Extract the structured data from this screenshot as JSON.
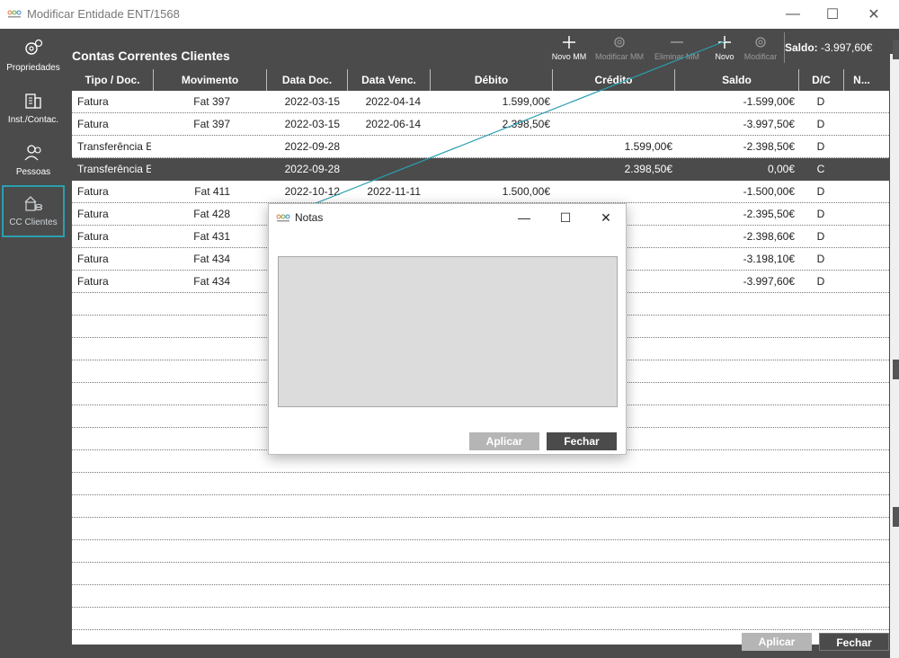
{
  "window": {
    "title": "Modificar Entidade ENT/1568",
    "controls": {
      "minimize": "—",
      "maximize": "☐",
      "close": "✕"
    }
  },
  "sidebar": {
    "items": [
      {
        "label": "Propriedades",
        "icon": "gears-icon"
      },
      {
        "label": "Inst./Contac.",
        "icon": "building-icon"
      },
      {
        "label": "Pessoas",
        "icon": "people-icon"
      },
      {
        "label": "CC Clientes",
        "icon": "cc-clientes-icon",
        "active": true
      }
    ]
  },
  "header": {
    "title": "Contas Correntes Clientes",
    "toolbar": {
      "novo_mm": "Novo MM",
      "modificar_mm": "Modificar MM",
      "eliminar_mm": "Eliminar MM",
      "novo": "Novo",
      "modificar": "Modificar"
    },
    "saldo_label": "Saldo:",
    "saldo_value": "-3.997,60€"
  },
  "table": {
    "columns": [
      "Tipo / Doc.",
      "Movimento",
      "Data Doc.",
      "Data Venc.",
      "Débito",
      "Crédito",
      "Saldo",
      "D/C",
      "N..."
    ],
    "rows": [
      {
        "tipo": "Fatura",
        "mov": "Fat 397",
        "data_doc": "2022-03-15",
        "data_venc": "2022-04-14",
        "debito": "1.599,00€",
        "credito": "",
        "saldo": "-1.599,00€",
        "dc": "D"
      },
      {
        "tipo": "Fatura",
        "mov": "Fat 397",
        "data_doc": "2022-03-15",
        "data_venc": "2022-06-14",
        "debito": "2.398,50€",
        "credito": "",
        "saldo": "-3.997,50€",
        "dc": "D"
      },
      {
        "tipo": "Transferência E",
        "mov": "",
        "data_doc": "2022-09-28",
        "data_venc": "",
        "debito": "",
        "credito": "1.599,00€",
        "saldo": "-2.398,50€",
        "dc": "D"
      },
      {
        "tipo": "Transferência E",
        "mov": "",
        "data_doc": "2022-09-28",
        "data_venc": "",
        "debito": "",
        "credito": "2.398,50€",
        "saldo": "0,00€",
        "dc": "C",
        "selected": true
      },
      {
        "tipo": "Fatura",
        "mov": "Fat 411",
        "data_doc": "2022-10-12",
        "data_venc": "2022-11-11",
        "debito": "1.500,00€",
        "credito": "",
        "saldo": "-1.500,00€",
        "dc": "D"
      },
      {
        "tipo": "Fatura",
        "mov": "Fat 428",
        "data_doc": "",
        "data_venc": "",
        "debito": "",
        "credito": "",
        "saldo": "-2.395,50€",
        "dc": "D"
      },
      {
        "tipo": "Fatura",
        "mov": "Fat 431",
        "data_doc": "",
        "data_venc": "",
        "debito": "",
        "credito": "",
        "saldo": "-2.398,60€",
        "dc": "D"
      },
      {
        "tipo": "Fatura",
        "mov": "Fat 434",
        "data_doc": "",
        "data_venc": "",
        "debito": "",
        "credito": "",
        "saldo": "-3.198,10€",
        "dc": "D"
      },
      {
        "tipo": "Fatura",
        "mov": "Fat 434",
        "data_doc": "",
        "data_venc": "",
        "debito": "",
        "credito": "",
        "saldo": "-3.997,60€",
        "dc": "D"
      }
    ]
  },
  "footer": {
    "aplicar": "Aplicar",
    "fechar": "Fechar"
  },
  "modal": {
    "title": "Notas",
    "notes_value": "",
    "aplicar": "Aplicar",
    "fechar": "Fechar"
  },
  "colors": {
    "dark": "#4b4b4b",
    "accent": "#2a9fb0",
    "disabled": "#b5b5b5"
  }
}
